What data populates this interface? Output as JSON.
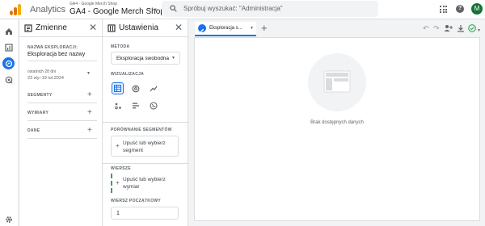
{
  "header": {
    "app_name": "Analytics",
    "property_subtitle": "GA4 - Google Merch Shop",
    "property_title": "GA4 - Google Merch Shop",
    "search_placeholder": "Spróbuj wyszukać: \"Administracja\"",
    "avatar_letter": "M",
    "help_label": "?"
  },
  "left_nav": {
    "icons": [
      "home-icon",
      "reports-icon",
      "explore-icon",
      "advertising-icon",
      "settings-icon"
    ],
    "active": "explore-icon"
  },
  "variables_panel": {
    "title": "Zmienne",
    "exploration_name_label": "NAZWA EKSPLORACJI:",
    "exploration_name": "Eksploracja bez nazwy",
    "date_chip": "ostatnich 28 dni",
    "date_range": "23 sty–19 lut 2024",
    "segments_label": "SEGMENTY",
    "dimensions_label": "WYMIARY",
    "metrics_label": "DANE"
  },
  "settings_panel": {
    "title": "Ustawienia",
    "method_label": "METODA",
    "method_value": "Eksploracja swobodna",
    "visualization_label": "WIZUALIZACJA",
    "visualizations": [
      "table-icon",
      "donut-chart-icon",
      "line-chart-icon",
      "scatter-icon",
      "bar-chart-icon",
      "geo-map-icon"
    ],
    "active_visualization": "table-icon",
    "segment_compare_label": "PORÓWNANIE SEGMENTÓW",
    "segment_drop_text": "Upuść lub wybierz segment",
    "rows_label": "WIERSZE",
    "rows_drop_text": "Upuść lub wybierz wymiar",
    "start_row_label": "WIERSZ POCZĄTKOWY",
    "start_row_value": "1"
  },
  "canvas": {
    "tab_label": "Eksploracja s...",
    "empty_text": "Brak dostępnych danych"
  },
  "colors": {
    "accent": "#1a73e8",
    "avatar": "#137333",
    "status_ok": "#34a853"
  }
}
